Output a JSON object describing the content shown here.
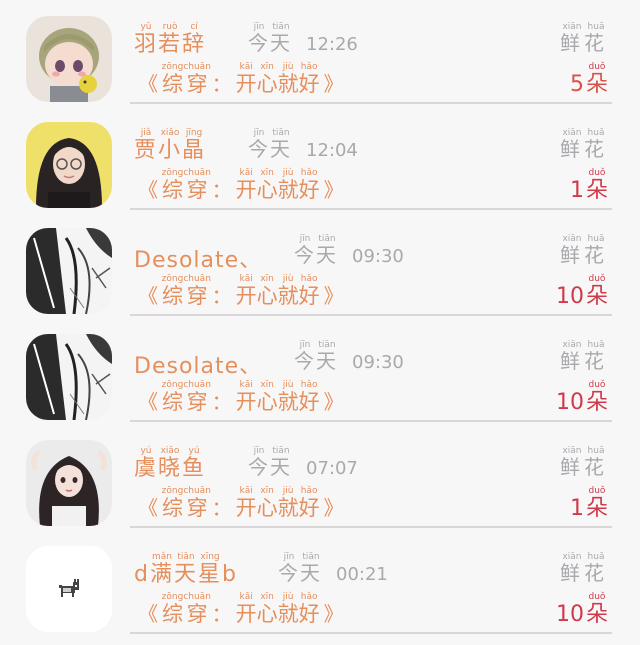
{
  "rows": [
    {
      "name": [
        {
          "c": "羽",
          "p": "yǔ"
        },
        {
          "c": "若",
          "p": "ruò"
        },
        {
          "c": "辞",
          "p": "cí"
        }
      ],
      "name_latin": "",
      "day": [
        {
          "c": "今",
          "p": "jīn"
        },
        {
          "c": "天",
          "p": "tiān"
        }
      ],
      "time": "12:26",
      "novel": {
        "open": "《",
        "colon": "：",
        "close": "》",
        "a": [
          {
            "c": "综",
            "p": "zōng"
          },
          {
            "c": "穿",
            "p": "chuān"
          }
        ],
        "b": [
          {
            "c": "开",
            "p": "kāi"
          },
          {
            "c": "心",
            "p": "xīn"
          },
          {
            "c": "就",
            "p": "jiù"
          },
          {
            "c": "好",
            "p": "hǎo"
          }
        ]
      },
      "flower": [
        {
          "c": "鲜",
          "p": "xiān"
        },
        {
          "c": "花",
          "p": "huā"
        }
      ],
      "count": "5",
      "unit": {
        "c": "朵",
        "p": "duǒ"
      },
      "count_color": "#d9524a"
    },
    {
      "name": [
        {
          "c": "贾",
          "p": "jiǎ"
        },
        {
          "c": "小",
          "p": "xiǎo"
        },
        {
          "c": "晶",
          "p": "jīng"
        }
      ],
      "name_latin": "",
      "day": [
        {
          "c": "今",
          "p": "jīn"
        },
        {
          "c": "天",
          "p": "tiān"
        }
      ],
      "time": "12:04",
      "novel": {
        "open": "《",
        "colon": "：",
        "close": "》",
        "a": [
          {
            "c": "综",
            "p": "zōng"
          },
          {
            "c": "穿",
            "p": "chuān"
          }
        ],
        "b": [
          {
            "c": "开",
            "p": "kāi"
          },
          {
            "c": "心",
            "p": "xīn"
          },
          {
            "c": "就",
            "p": "jiù"
          },
          {
            "c": "好",
            "p": "hǎo"
          }
        ]
      },
      "flower": [
        {
          "c": "鲜",
          "p": "xiān"
        },
        {
          "c": "花",
          "p": "huā"
        }
      ],
      "count": "1",
      "unit": {
        "c": "朵",
        "p": "duǒ"
      },
      "count_color": "#cf3a4a"
    },
    {
      "name": [],
      "name_latin": "Desolate、",
      "day": [
        {
          "c": "今",
          "p": "jīn"
        },
        {
          "c": "天",
          "p": "tiān"
        }
      ],
      "time": "09:30",
      "novel": {
        "open": "《",
        "colon": "：",
        "close": "》",
        "a": [
          {
            "c": "综",
            "p": "zōng"
          },
          {
            "c": "穿",
            "p": "chuān"
          }
        ],
        "b": [
          {
            "c": "开",
            "p": "kāi"
          },
          {
            "c": "心",
            "p": "xīn"
          },
          {
            "c": "就",
            "p": "jiù"
          },
          {
            "c": "好",
            "p": "hǎo"
          }
        ]
      },
      "flower": [
        {
          "c": "鲜",
          "p": "xiān"
        },
        {
          "c": "花",
          "p": "huā"
        }
      ],
      "count": "10",
      "unit": {
        "c": "朵",
        "p": "duǒ"
      },
      "count_color": "#cf3a4a"
    },
    {
      "name": [],
      "name_latin": "Desolate、",
      "day": [
        {
          "c": "今",
          "p": "jīn"
        },
        {
          "c": "天",
          "p": "tiān"
        }
      ],
      "time": "09:30",
      "novel": {
        "open": "《",
        "colon": "：",
        "close": "》",
        "a": [
          {
            "c": "综",
            "p": "zōng"
          },
          {
            "c": "穿",
            "p": "chuān"
          }
        ],
        "b": [
          {
            "c": "开",
            "p": "kāi"
          },
          {
            "c": "心",
            "p": "xīn"
          },
          {
            "c": "就",
            "p": "jiù"
          },
          {
            "c": "好",
            "p": "hǎo"
          }
        ]
      },
      "flower": [
        {
          "c": "鲜",
          "p": "xiān"
        },
        {
          "c": "花",
          "p": "huā"
        }
      ],
      "count": "10",
      "unit": {
        "c": "朵",
        "p": "duǒ"
      },
      "count_color": "#cf3a4a"
    },
    {
      "name": [
        {
          "c": "虞",
          "p": "yú"
        },
        {
          "c": "晓",
          "p": "xiǎo"
        },
        {
          "c": "鱼",
          "p": "yú"
        }
      ],
      "name_latin": "",
      "day": [
        {
          "c": "今",
          "p": "jīn"
        },
        {
          "c": "天",
          "p": "tiān"
        }
      ],
      "time": "07:07",
      "novel": {
        "open": "《",
        "colon": "：",
        "close": "》",
        "a": [
          {
            "c": "综",
            "p": "zōng"
          },
          {
            "c": "穿",
            "p": "chuān"
          }
        ],
        "b": [
          {
            "c": "开",
            "p": "kāi"
          },
          {
            "c": "心",
            "p": "xīn"
          },
          {
            "c": "就",
            "p": "jiù"
          },
          {
            "c": "好",
            "p": "hǎo"
          }
        ]
      },
      "flower": [
        {
          "c": "鲜",
          "p": "xiān"
        },
        {
          "c": "花",
          "p": "huā"
        }
      ],
      "count": "1",
      "unit": {
        "c": "朵",
        "p": "duǒ"
      },
      "count_color": "#cf3a4a"
    },
    {
      "name": [
        {
          "c": "d",
          "p": ""
        },
        {
          "c": "满",
          "p": "mǎn"
        },
        {
          "c": "天",
          "p": "tiān"
        },
        {
          "c": "星",
          "p": "xīng"
        },
        {
          "c": "b",
          "p": ""
        }
      ],
      "name_latin": "",
      "day": [
        {
          "c": "今",
          "p": "jīn"
        },
        {
          "c": "天",
          "p": "tiān"
        }
      ],
      "time": "00:21",
      "novel": {
        "open": "《",
        "colon": "：",
        "close": "》",
        "a": [
          {
            "c": "综",
            "p": "zōng"
          },
          {
            "c": "穿",
            "p": "chuān"
          }
        ],
        "b": [
          {
            "c": "开",
            "p": "kāi"
          },
          {
            "c": "心",
            "p": "xīn"
          },
          {
            "c": "就",
            "p": "jiù"
          },
          {
            "c": "好",
            "p": "hǎo"
          }
        ]
      },
      "flower": [
        {
          "c": "鲜",
          "p": "xiān"
        },
        {
          "c": "花",
          "p": "huā"
        }
      ],
      "count": "10",
      "unit": {
        "c": "朵",
        "p": "duǒ"
      },
      "count_color": "#cf3a4a"
    }
  ],
  "avatars": [
    "chibi-boy-avatar",
    "girl-glasses-avatar",
    "manga-sketch-avatar",
    "manga-sketch-avatar",
    "long-hair-girl-avatar",
    "pixel-dog-avatar"
  ],
  "colors": {
    "accent": "#e58f5c",
    "muted": "#a9a9ad",
    "count": "#cf3a4a",
    "divider": "#d9d6d8",
    "background": "#f8f7f8"
  }
}
